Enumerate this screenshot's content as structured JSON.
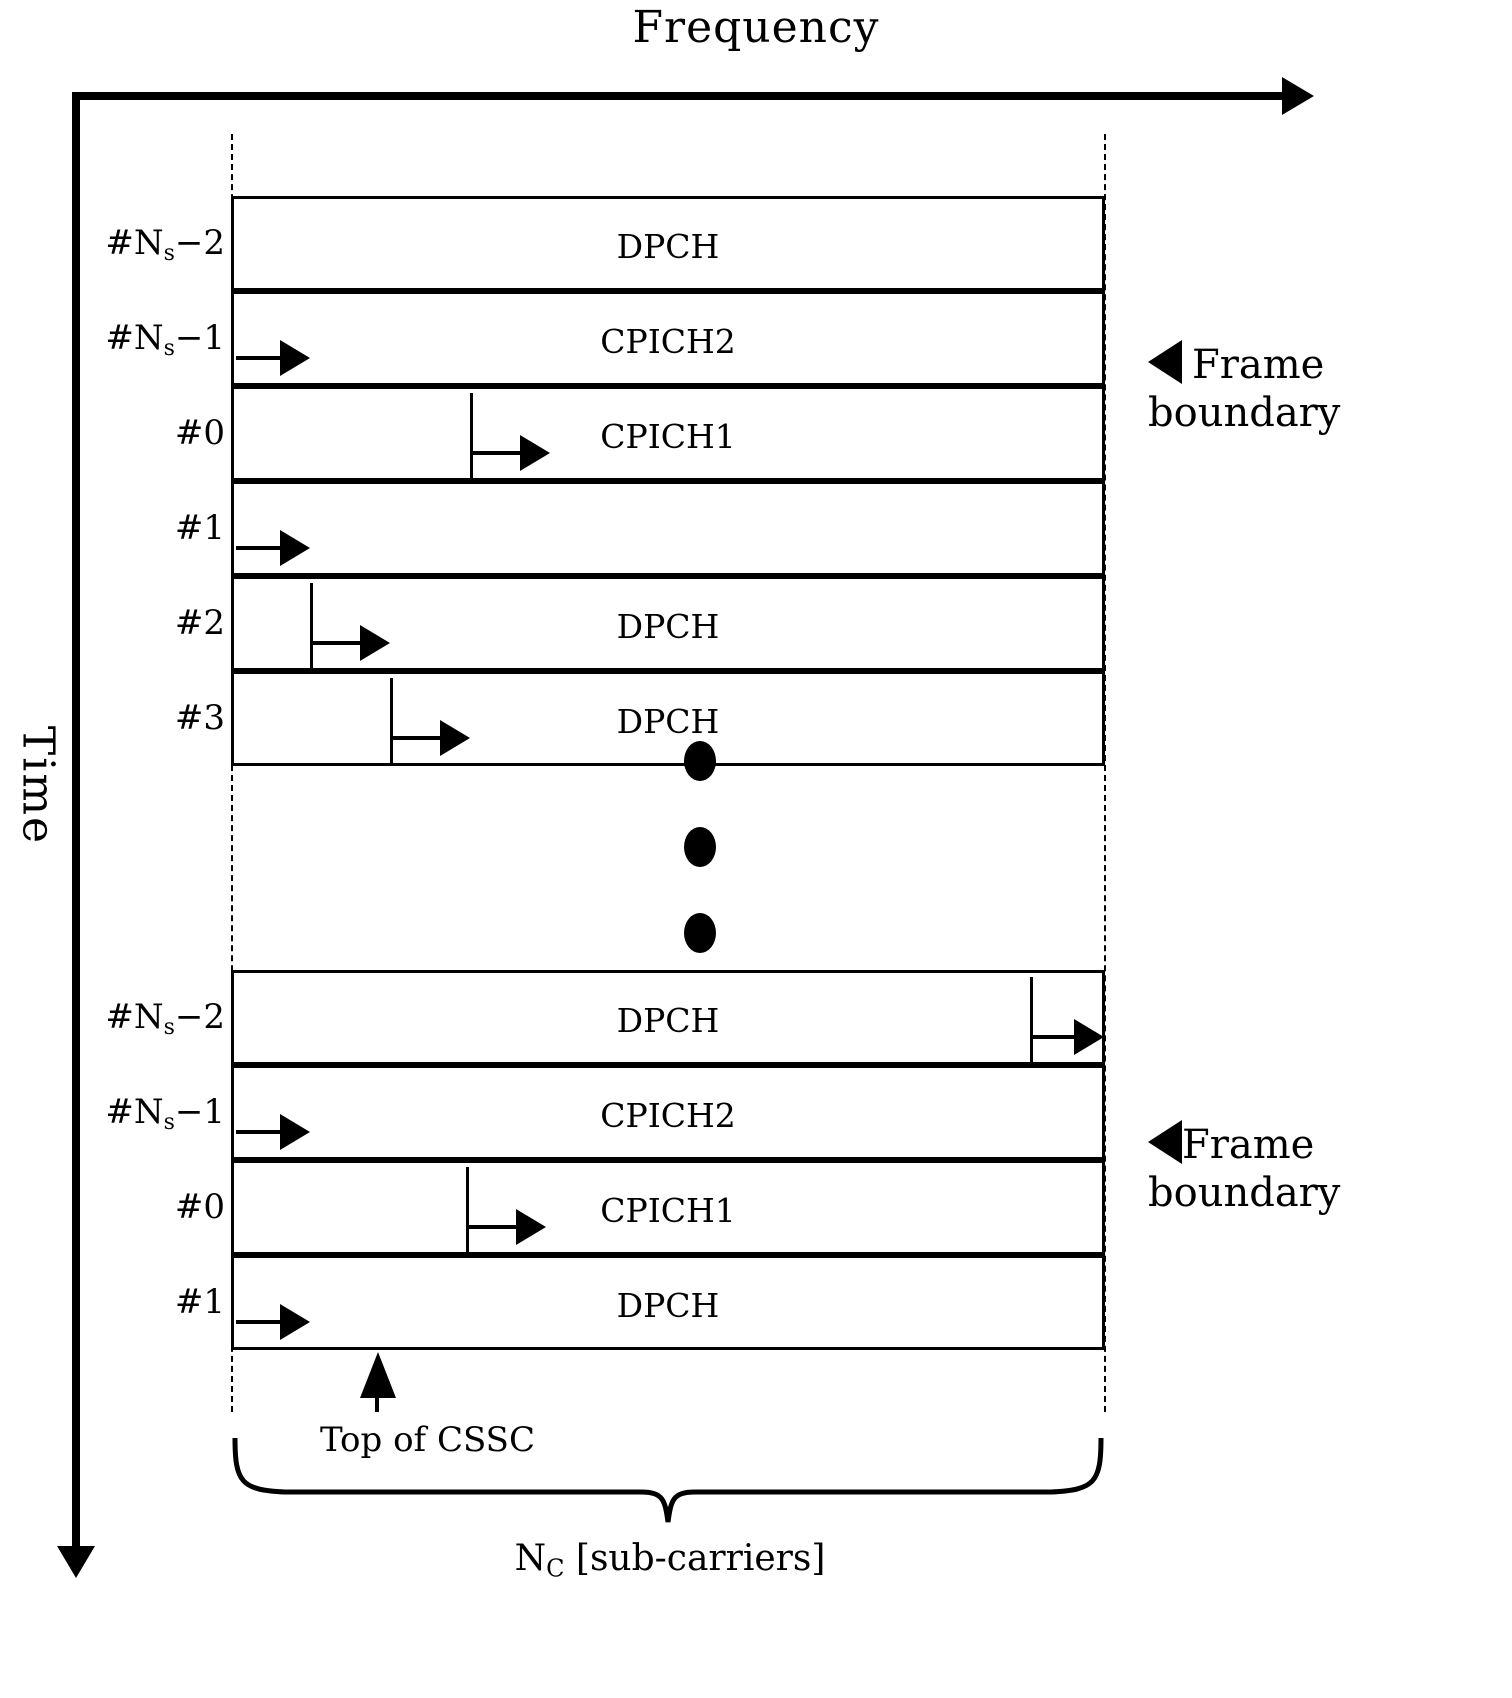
{
  "axes": {
    "x_title": "Frequency",
    "y_title": "Time"
  },
  "chart_data": {
    "type": "table",
    "title": "OFDM frame structure: slots over frequency and time",
    "xlabel": "Frequency",
    "ylabel": "Time",
    "columns": [
      "slot_index",
      "channel"
    ],
    "rows": [
      {
        "slot_index": "#N",
        "slot_sub": "s",
        "slot_tail": "−2",
        "channel": "DPCH",
        "arrow_offset_pct": null,
        "arrow_at_right": false
      },
      {
        "slot_index": "#N",
        "slot_sub": "s",
        "slot_tail": "−1",
        "channel": "CPICH2",
        "arrow_offset_pct": 0,
        "arrow_at_right": false
      },
      {
        "slot_index": "#0",
        "slot_sub": "",
        "slot_tail": "",
        "channel": "CPICH1",
        "arrow_offset_pct": 27,
        "arrow_at_right": false
      },
      {
        "slot_index": "#1",
        "slot_sub": "",
        "slot_tail": "",
        "channel": "",
        "arrow_offset_pct": 0,
        "arrow_at_right": false
      },
      {
        "slot_index": "#2",
        "slot_sub": "",
        "slot_tail": "",
        "channel": "DPCH",
        "arrow_offset_pct": 9,
        "arrow_at_right": false
      },
      {
        "slot_index": "#3",
        "slot_sub": "",
        "slot_tail": "",
        "channel": "DPCH",
        "arrow_offset_pct": 18,
        "arrow_at_right": false
      },
      {
        "slot_index": "#N",
        "slot_sub": "s",
        "slot_tail": "−2",
        "channel": "DPCH",
        "arrow_offset_pct": 91,
        "arrow_at_right": true
      },
      {
        "slot_index": "#N",
        "slot_sub": "s",
        "slot_tail": "−1",
        "channel": "CPICH2",
        "arrow_offset_pct": 0,
        "arrow_at_right": false
      },
      {
        "slot_index": "#0",
        "slot_sub": "",
        "slot_tail": "",
        "channel": "CPICH1",
        "arrow_offset_pct": 27,
        "arrow_at_right": false
      },
      {
        "slot_index": "#1",
        "slot_sub": "",
        "slot_tail": "",
        "channel": "DPCH",
        "arrow_offset_pct": 0,
        "arrow_at_right": false
      }
    ],
    "continuation_marker": "vertical-ellipsis",
    "annotations": [
      {
        "id": "frame-boundary-1",
        "text_line1": "Frame",
        "text_line2": "boundary"
      },
      {
        "id": "frame-boundary-2",
        "text_line1": "Frame",
        "text_line2": "boundary"
      },
      {
        "id": "top-of-cssc",
        "text": "Top of CSSC"
      },
      {
        "id": "band-width",
        "text_main": "[sub-carriers]",
        "symbol": "N",
        "symbol_sub": "C"
      }
    ]
  },
  "labels": {
    "ns_minus_2": "#N",
    "ns_sub": "s",
    "minus_two": "−2",
    "minus_one": "−1",
    "slot0": "#0",
    "slot1": "#1",
    "slot2": "#2",
    "slot3": "#3",
    "dpch": "DPCH",
    "cpich1": "CPICH1",
    "cpich2": "CPICH2",
    "empty": "",
    "frame_line1": "Frame",
    "frame_line2": "boundary",
    "cssc": "Top of CSSC",
    "nc_symbol": "N",
    "nc_sub": "C",
    "nc_rest": " [sub-carriers]"
  }
}
